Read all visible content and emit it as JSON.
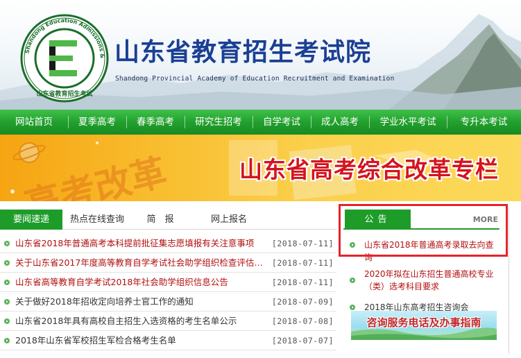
{
  "header": {
    "site_title": "山东省教育招生考试院",
    "site_subtitle": "Shandong Provincial Academy of Education Recruitment and Examination",
    "logo_ring_text": "Shandong Education Admissions & Examinations",
    "logo_bottom_text": "山东省教育招生考试",
    "logo_letter": "E"
  },
  "nav": {
    "items": [
      {
        "label": "网站首页"
      },
      {
        "label": "夏季高考"
      },
      {
        "label": "春季高考"
      },
      {
        "label": "研究生招考"
      },
      {
        "label": "自学考试"
      },
      {
        "label": "成人高考"
      },
      {
        "label": "学业水平考试"
      },
      {
        "label": "专升本考试"
      }
    ]
  },
  "banner": {
    "title": "山东省高考综合改革专栏",
    "deco_text": "高考改革"
  },
  "news": {
    "tabs": [
      {
        "label": "要闻速递",
        "active": true
      },
      {
        "label": "热点在线查询",
        "active": false
      },
      {
        "label": "简　报",
        "active": false
      },
      {
        "label": "网上报名",
        "active": false
      }
    ],
    "items": [
      {
        "title": "山东省2018年普通高考本科提前批征集志愿填报有关注意事项",
        "date": "[2018-07-11]",
        "color": "red"
      },
      {
        "title": "关于山东省2017年度高等教育自学考试社会助学组织检查评估…",
        "date": "[2018-07-11]",
        "color": "red"
      },
      {
        "title": "山东省高等教育自学考试2018年社会助学组织信息公告",
        "date": "[2018-07-11]",
        "color": "red"
      },
      {
        "title": "关于做好2018年招收定向培养士官工作的通知",
        "date": "[2018-07-09]",
        "color": "gray"
      },
      {
        "title": "山东省2018年具有高校自主招生入选资格的考生名单公示",
        "date": "[2018-07-08]",
        "color": "gray"
      },
      {
        "title": "2018年山东省军校招生军检合格考生名单",
        "date": "[2018-07-07]",
        "color": "gray"
      }
    ]
  },
  "notice": {
    "tab_label": "公告",
    "more_label": "MORE",
    "items": [
      {
        "text": "山东省2018年普通高考录取去向查询",
        "color": "red"
      },
      {
        "text": "2020年拟在山东招生普通高校专业（类）选考科目要求",
        "color": "red"
      },
      {
        "text": "2018年山东高考招生咨询会",
        "color": "gray"
      }
    ],
    "ad_text": "咨询服务电话及办事指南"
  },
  "colors": {
    "nav_green": "#23a02e",
    "title_blue": "#1b3f93",
    "banner_red": "#d4141e",
    "news_red": "#b11010",
    "highlight": "#e3242b"
  }
}
